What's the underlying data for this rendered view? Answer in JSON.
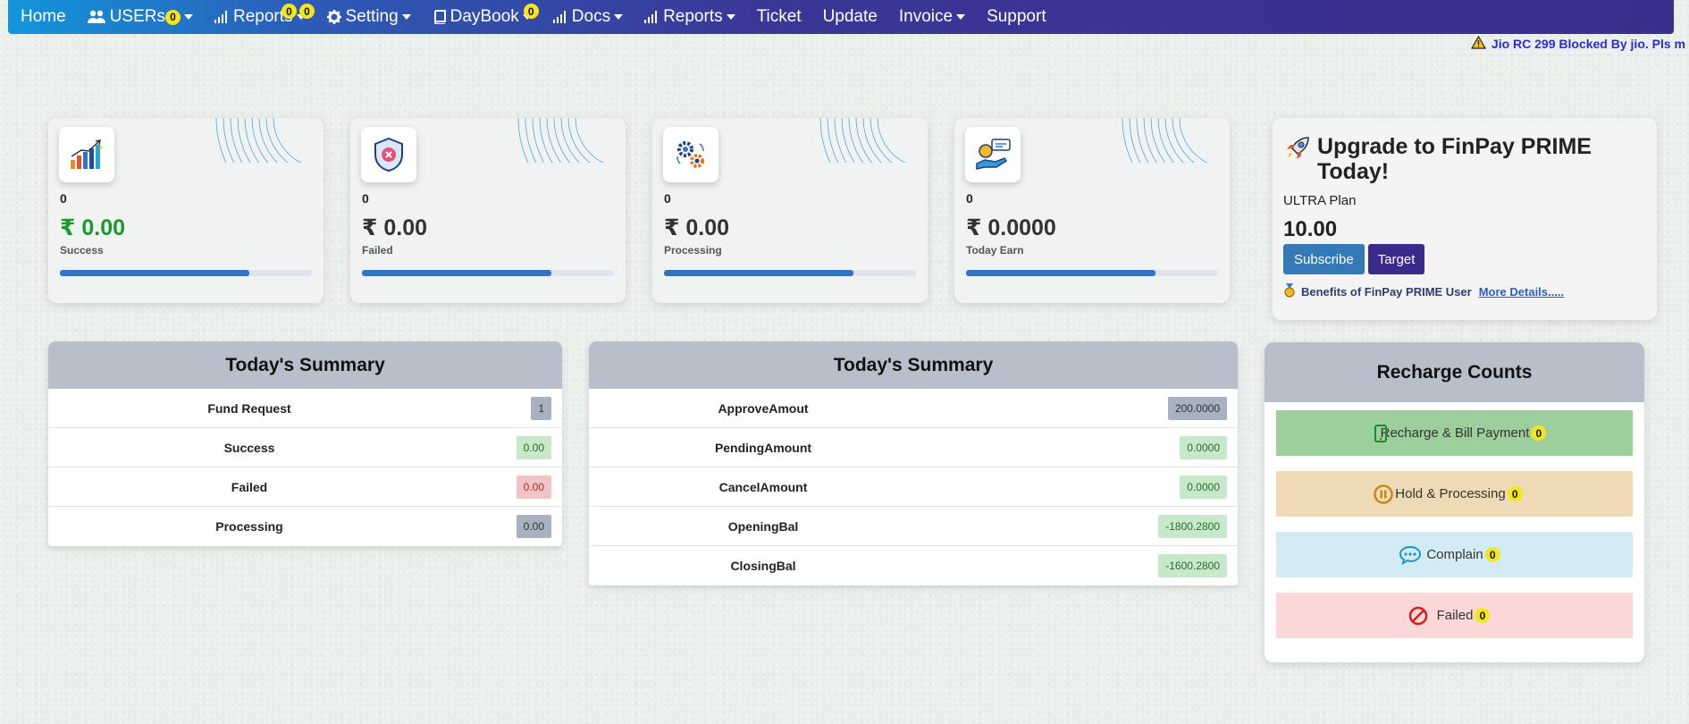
{
  "nav": {
    "home": "Home",
    "users": "USERs",
    "users_badge": "0",
    "reports1": "Reports",
    "reports1_badge_a": "0",
    "reports1_badge_b": "0",
    "setting": "Setting",
    "daybook": "DayBook",
    "daybook_badge": "0",
    "docs": "Docs",
    "reports2": "Reports",
    "ticket": "Ticket",
    "update": "Update",
    "invoice": "Invoice",
    "support": "Support"
  },
  "marquee": "Jio RC 299 Blocked By jio. Pls m",
  "stats": [
    {
      "count": "0",
      "amount": "₹ 0.00",
      "label": "Success",
      "icon": "growth-chart-icon",
      "progress_pct": 75
    },
    {
      "count": "0",
      "amount": "₹ 0.00",
      "label": "Failed",
      "icon": "shield-fail-icon",
      "progress_pct": 75
    },
    {
      "count": "0",
      "amount": "₹ 0.00",
      "label": "Processing",
      "icon": "gears-icon",
      "progress_pct": 75
    },
    {
      "count": "0",
      "amount": "₹ 0.0000",
      "label": "Today Earn",
      "icon": "hand-coin-icon",
      "progress_pct": 75
    }
  ],
  "prime": {
    "title": "Upgrade to FinPay PRIME Today!",
    "plan": "ULTRA Plan",
    "price": "10.00",
    "subscribe": "Subscribe",
    "target": "Target",
    "benefits": "Benefits of FinPay PRIME User",
    "more": "More Details....."
  },
  "summary1": {
    "title": "Today's Summary",
    "rows": [
      {
        "label": "Fund Request",
        "value": "1",
        "style": "grey"
      },
      {
        "label": "Success",
        "value": "0.00",
        "style": "green"
      },
      {
        "label": "Failed",
        "value": "0.00",
        "style": "red"
      },
      {
        "label": "Processing",
        "value": "0.00",
        "style": "grey"
      }
    ]
  },
  "summary2": {
    "title": "Today's Summary",
    "rows": [
      {
        "label": "ApproveAmout",
        "value": "200.0000",
        "style": "grey"
      },
      {
        "label": "PendingAmount",
        "value": "0.0000",
        "style": "green"
      },
      {
        "label": "CancelAmount",
        "value": "0.0000",
        "style": "green"
      },
      {
        "label": "OpeningBal",
        "value": "-1800.2800",
        "style": "green"
      },
      {
        "label": "ClosingBal",
        "value": "-1600.2800",
        "style": "green"
      }
    ]
  },
  "recharge": {
    "title": "Recharge Counts",
    "items": [
      {
        "label": "Recharge & Bill Payment",
        "count": "0",
        "bg": "#9ccf9c",
        "icon": "mobile-phone-icon"
      },
      {
        "label": "Hold & Processing",
        "count": "0",
        "bg": "#eedbb6",
        "icon": "pause-circle-icon"
      },
      {
        "label": "Complain",
        "count": "0",
        "bg": "#d3ebf3",
        "icon": "chat-bubble-icon"
      },
      {
        "label": "Failed",
        "count": "0",
        "bg": "#fbd8d8",
        "icon": "ban-icon"
      }
    ]
  }
}
